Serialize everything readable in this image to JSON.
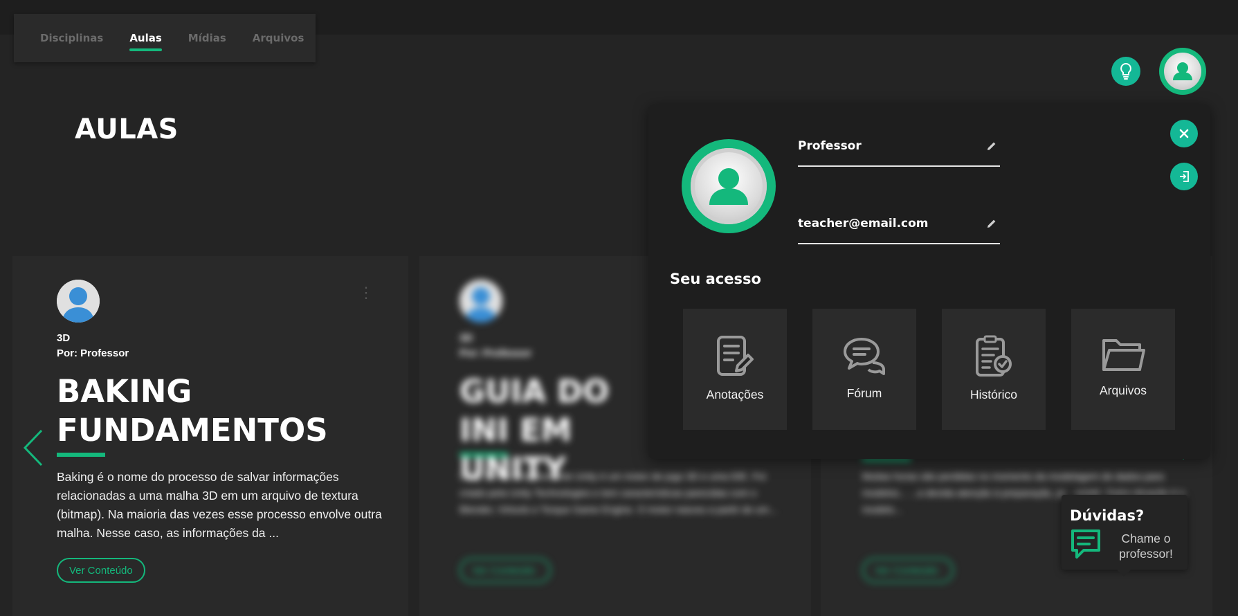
{
  "nav": {
    "tabs": [
      {
        "label": "Disciplinas"
      },
      {
        "label": "Aulas"
      },
      {
        "label": "Mídias"
      },
      {
        "label": "Arquivos"
      }
    ]
  },
  "page": {
    "title": "AULAS"
  },
  "cards": [
    {
      "category": "3D",
      "author": "Por: Professor",
      "title": "BAKING FUNDAMENTOS",
      "description": "Baking é o nome do processo de salvar informações relacionadas a uma malha 3D em um arquivo de textura (bitmap). Na maioria das vezes esse processo envolve outra malha. Nesse caso, as informações da ...",
      "button": "Ver Conteúdo"
    },
    {
      "category": "3D",
      "author": "Por: Professor",
      "title": "GUIA DO INI EM UNITY",
      "description": "Unity 3D ou simplesmente Unity é um motor de jogo 3D e uma IDE. Foi criado pela Unity Technologies e tem características parecidas com o Blender, Virtools e Torque Game Engine. O motor nasceu a partir de um...",
      "button": "Ver Conteúdo"
    },
    {
      "description": "Muitas horas são perdidas no momento da modelagem de dados para modelos... ...a devida atenção à preparação, pr... existir. Outra situação é o modelo...",
      "button": "Ver Conteúdo"
    }
  ],
  "profile": {
    "name": "Professor",
    "email": "teacher@email.com",
    "access_title": "Seu acesso",
    "tiles": [
      {
        "label": "Anotações",
        "icon": "notes-icon"
      },
      {
        "label": "Fórum",
        "icon": "forum-icon"
      },
      {
        "label": "Histórico",
        "icon": "history-icon"
      },
      {
        "label": "Arquivos",
        "icon": "folder-icon"
      }
    ]
  },
  "help": {
    "title": "Dúvidas?",
    "text": "Chame o professor!"
  },
  "colors": {
    "accent": "#14b87c",
    "teal": "#14b896",
    "background": "#242424",
    "panel": "#1e1e1e"
  }
}
